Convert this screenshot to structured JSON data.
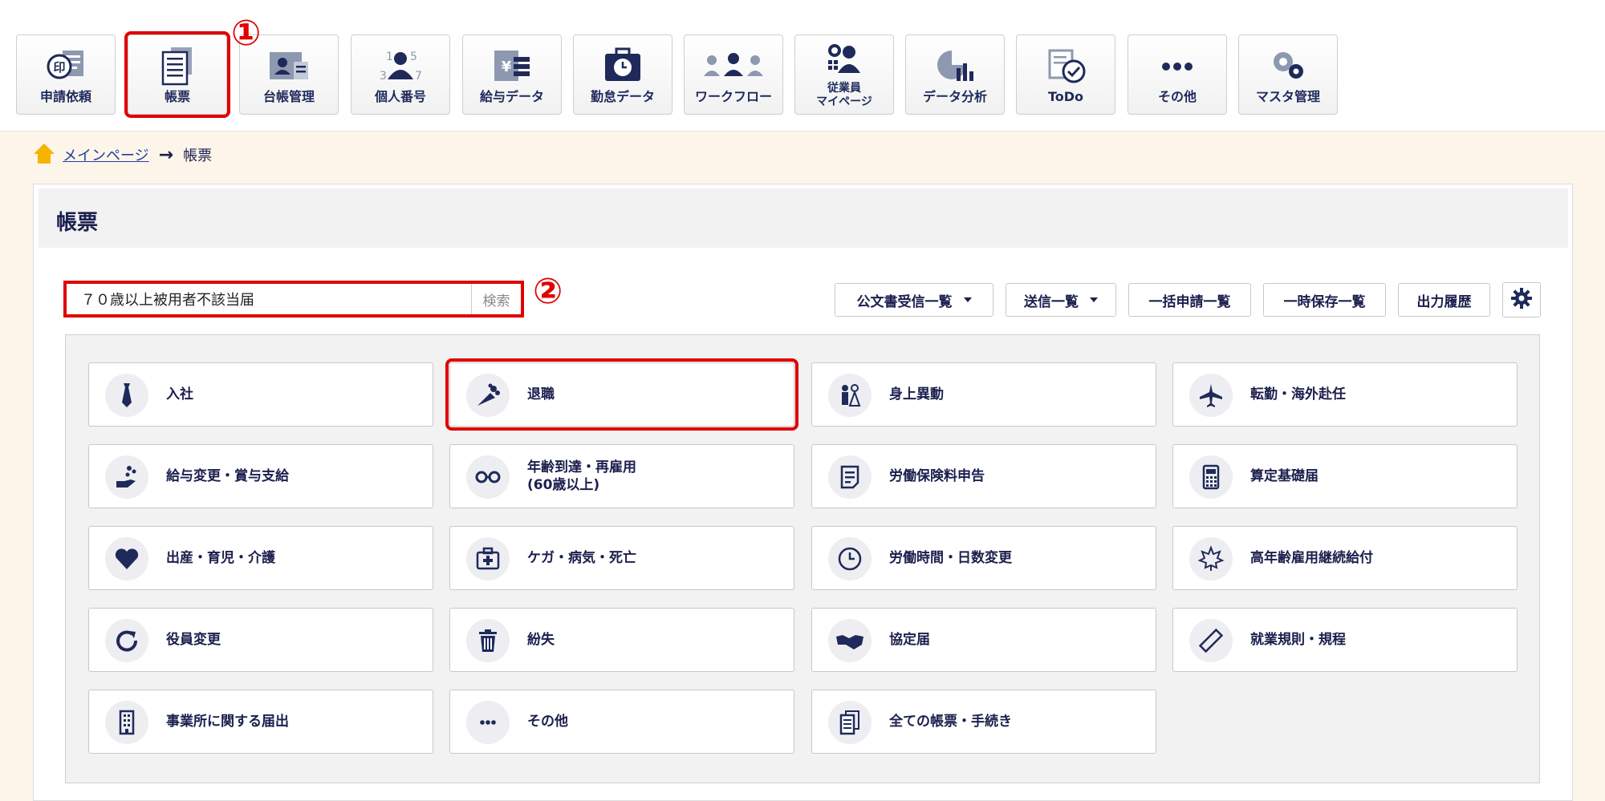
{
  "nav": {
    "items": [
      {
        "label": "申請依頼",
        "icon": "stamp-icon"
      },
      {
        "label": "帳票",
        "icon": "document-list-icon"
      },
      {
        "label": "台帳管理",
        "icon": "id-card-icon"
      },
      {
        "label": "個人番号",
        "icon": "person-number-icon"
      },
      {
        "label": "給与データ",
        "icon": "payroll-icon"
      },
      {
        "label": "勤怠データ",
        "icon": "clock-bag-icon"
      },
      {
        "label": "ワークフロー",
        "icon": "workflow-icon"
      },
      {
        "label": "従業員\nマイページ",
        "icon": "employee-gear-icon"
      },
      {
        "label": "データ分析",
        "icon": "chart-icon"
      },
      {
        "label": "ToDo",
        "icon": "todo-check-icon"
      },
      {
        "label": "その他",
        "icon": "more-dots-icon"
      },
      {
        "label": "マスタ管理",
        "icon": "gears-icon"
      }
    ],
    "selected": "帳票"
  },
  "callouts": {
    "one": "①",
    "two": "②"
  },
  "breadcrumb": {
    "home": "メインページ",
    "current": "帳票"
  },
  "page": {
    "title": "帳票"
  },
  "search": {
    "value": "７０歳以上被用者不該当届",
    "button": "検索"
  },
  "toolbar": {
    "received": "公文書受信一覧",
    "sent": "送信一覧",
    "bulk": "一括申請一覧",
    "saved": "一時保存一覧",
    "history": "出力履歴"
  },
  "categories": [
    {
      "label": "入社",
      "icon": "necktie-icon"
    },
    {
      "label": "退職",
      "icon": "bouquet-icon"
    },
    {
      "label": "身上異動",
      "icon": "couple-icon"
    },
    {
      "label": "転勤・海外赴任",
      "icon": "airplane-icon"
    },
    {
      "label": "給与変更・賞与支給",
      "icon": "hand-coins-icon"
    },
    {
      "label": "年齢到達・再雇用\n(60歳以上)",
      "icon": "glasses-icon"
    },
    {
      "label": "労働保険料申告",
      "icon": "document-icon"
    },
    {
      "label": "算定基礎届",
      "icon": "calculator-icon"
    },
    {
      "label": "出産・育児・介護",
      "icon": "heart-icon"
    },
    {
      "label": "ケガ・病気・死亡",
      "icon": "first-aid-icon"
    },
    {
      "label": "労働時間・日数変更",
      "icon": "clock-icon"
    },
    {
      "label": "高年齢雇用継続給付",
      "icon": "maple-leaf-icon"
    },
    {
      "label": "役員変更",
      "icon": "refresh-icon"
    },
    {
      "label": "紛失",
      "icon": "trash-icon"
    },
    {
      "label": "協定届",
      "icon": "handshake-icon"
    },
    {
      "label": "就業規則・規程",
      "icon": "ruler-icon"
    },
    {
      "label": "事業所に関する届出",
      "icon": "building-icon"
    },
    {
      "label": "その他",
      "icon": "more-dots-icon"
    },
    {
      "label": "全ての帳票・手続き",
      "icon": "documents-icon"
    }
  ],
  "selected_category": "退職",
  "colors": {
    "highlight": "#e00000",
    "accent": "#1b1f4d",
    "background": "#fdf5ea"
  }
}
